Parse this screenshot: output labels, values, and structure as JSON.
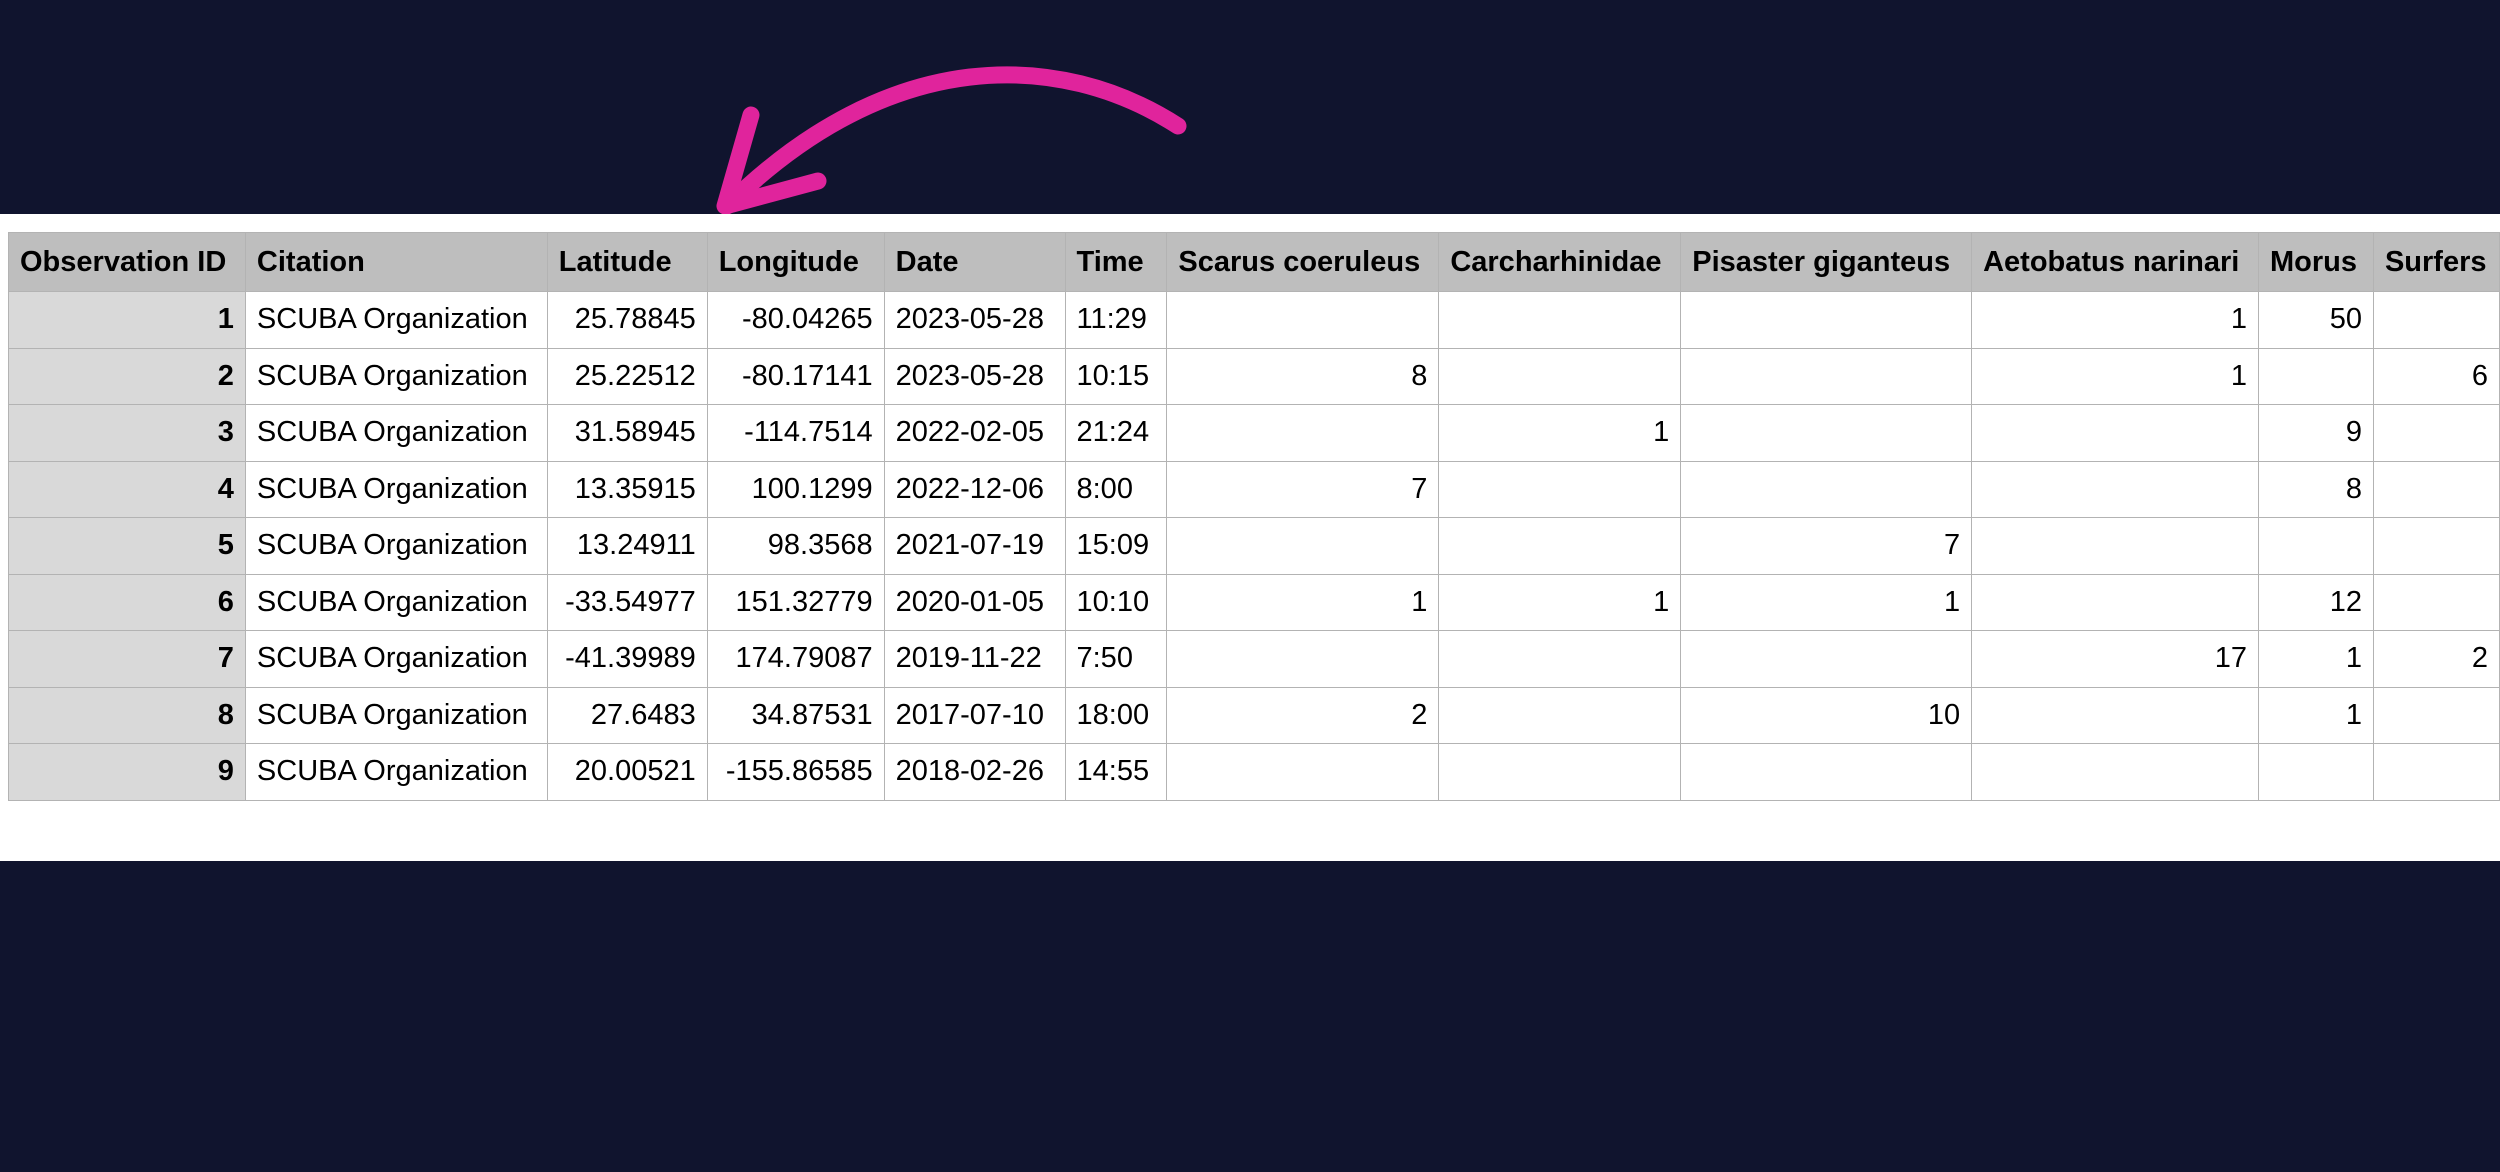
{
  "colors": {
    "background": "#10142e",
    "sheet": "#ffffff",
    "header_fill": "#bebebe",
    "id_fill": "#d9d9d9",
    "arrow": "#e0249c"
  },
  "icons": {
    "arrow": "curved-arrow-icon"
  },
  "table": {
    "columns": [
      "Observation ID",
      "Citation",
      "Latitude",
      "Longitude",
      "Date",
      "Time",
      "Scarus coeruleus",
      "Carcharhinidae",
      "Pisaster giganteus",
      "Aetobatus narinari",
      "Morus",
      "Surfers"
    ],
    "rows": [
      [
        "1",
        "SCUBA Organization",
        "25.78845",
        "-80.04265",
        "2023-05-28",
        "11:29",
        "",
        "",
        "",
        "1",
        "50",
        ""
      ],
      [
        "2",
        "SCUBA Organization",
        "25.22512",
        "-80.17141",
        "2023-05-28",
        "10:15",
        "8",
        "",
        "",
        "1",
        "",
        "6"
      ],
      [
        "3",
        "SCUBA Organization",
        "31.58945",
        "-114.7514",
        "2022-02-05",
        "21:24",
        "",
        "1",
        "",
        "",
        "9",
        ""
      ],
      [
        "4",
        "SCUBA Organization",
        "13.35915",
        "100.1299",
        "2022-12-06",
        "8:00",
        "7",
        "",
        "",
        "",
        "8",
        ""
      ],
      [
        "5",
        "SCUBA Organization",
        "13.24911",
        "98.3568",
        "2021-07-19",
        "15:09",
        "",
        "",
        "7",
        "",
        "",
        ""
      ],
      [
        "6",
        "SCUBA Organization",
        "-33.54977",
        "151.32779",
        "2020-01-05",
        "10:10",
        "1",
        "1",
        "1",
        "",
        "12",
        ""
      ],
      [
        "7",
        "SCUBA Organization",
        "-41.39989",
        "174.79087",
        "2019-11-22",
        "7:50",
        "",
        "",
        "",
        "17",
        "1",
        "2"
      ],
      [
        "8",
        "SCUBA Organization",
        "27.6483",
        "34.87531",
        "2017-07-10",
        "18:00",
        "2",
        "",
        "10",
        "",
        "1",
        ""
      ],
      [
        "9",
        "SCUBA Organization",
        "20.00521",
        "-155.86585",
        "2018-02-26",
        "14:55",
        "",
        "",
        "",
        "",
        "",
        ""
      ]
    ]
  }
}
